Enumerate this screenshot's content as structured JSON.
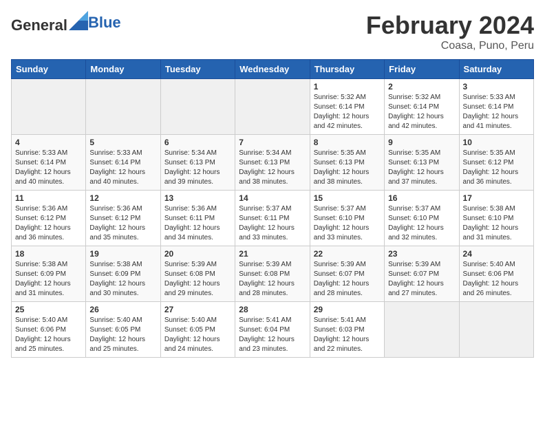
{
  "header": {
    "logo_general": "General",
    "logo_blue": "Blue",
    "month_year": "February 2024",
    "location": "Coasa, Puno, Peru"
  },
  "days_of_week": [
    "Sunday",
    "Monday",
    "Tuesday",
    "Wednesday",
    "Thursday",
    "Friday",
    "Saturday"
  ],
  "weeks": [
    [
      {
        "num": "",
        "info": ""
      },
      {
        "num": "",
        "info": ""
      },
      {
        "num": "",
        "info": ""
      },
      {
        "num": "",
        "info": ""
      },
      {
        "num": "1",
        "info": "Sunrise: 5:32 AM\nSunset: 6:14 PM\nDaylight: 12 hours\nand 42 minutes."
      },
      {
        "num": "2",
        "info": "Sunrise: 5:32 AM\nSunset: 6:14 PM\nDaylight: 12 hours\nand 42 minutes."
      },
      {
        "num": "3",
        "info": "Sunrise: 5:33 AM\nSunset: 6:14 PM\nDaylight: 12 hours\nand 41 minutes."
      }
    ],
    [
      {
        "num": "4",
        "info": "Sunrise: 5:33 AM\nSunset: 6:14 PM\nDaylight: 12 hours\nand 40 minutes."
      },
      {
        "num": "5",
        "info": "Sunrise: 5:33 AM\nSunset: 6:14 PM\nDaylight: 12 hours\nand 40 minutes."
      },
      {
        "num": "6",
        "info": "Sunrise: 5:34 AM\nSunset: 6:13 PM\nDaylight: 12 hours\nand 39 minutes."
      },
      {
        "num": "7",
        "info": "Sunrise: 5:34 AM\nSunset: 6:13 PM\nDaylight: 12 hours\nand 38 minutes."
      },
      {
        "num": "8",
        "info": "Sunrise: 5:35 AM\nSunset: 6:13 PM\nDaylight: 12 hours\nand 38 minutes."
      },
      {
        "num": "9",
        "info": "Sunrise: 5:35 AM\nSunset: 6:13 PM\nDaylight: 12 hours\nand 37 minutes."
      },
      {
        "num": "10",
        "info": "Sunrise: 5:35 AM\nSunset: 6:12 PM\nDaylight: 12 hours\nand 36 minutes."
      }
    ],
    [
      {
        "num": "11",
        "info": "Sunrise: 5:36 AM\nSunset: 6:12 PM\nDaylight: 12 hours\nand 36 minutes."
      },
      {
        "num": "12",
        "info": "Sunrise: 5:36 AM\nSunset: 6:12 PM\nDaylight: 12 hours\nand 35 minutes."
      },
      {
        "num": "13",
        "info": "Sunrise: 5:36 AM\nSunset: 6:11 PM\nDaylight: 12 hours\nand 34 minutes."
      },
      {
        "num": "14",
        "info": "Sunrise: 5:37 AM\nSunset: 6:11 PM\nDaylight: 12 hours\nand 33 minutes."
      },
      {
        "num": "15",
        "info": "Sunrise: 5:37 AM\nSunset: 6:10 PM\nDaylight: 12 hours\nand 33 minutes."
      },
      {
        "num": "16",
        "info": "Sunrise: 5:37 AM\nSunset: 6:10 PM\nDaylight: 12 hours\nand 32 minutes."
      },
      {
        "num": "17",
        "info": "Sunrise: 5:38 AM\nSunset: 6:10 PM\nDaylight: 12 hours\nand 31 minutes."
      }
    ],
    [
      {
        "num": "18",
        "info": "Sunrise: 5:38 AM\nSunset: 6:09 PM\nDaylight: 12 hours\nand 31 minutes."
      },
      {
        "num": "19",
        "info": "Sunrise: 5:38 AM\nSunset: 6:09 PM\nDaylight: 12 hours\nand 30 minutes."
      },
      {
        "num": "20",
        "info": "Sunrise: 5:39 AM\nSunset: 6:08 PM\nDaylight: 12 hours\nand 29 minutes."
      },
      {
        "num": "21",
        "info": "Sunrise: 5:39 AM\nSunset: 6:08 PM\nDaylight: 12 hours\nand 28 minutes."
      },
      {
        "num": "22",
        "info": "Sunrise: 5:39 AM\nSunset: 6:07 PM\nDaylight: 12 hours\nand 28 minutes."
      },
      {
        "num": "23",
        "info": "Sunrise: 5:39 AM\nSunset: 6:07 PM\nDaylight: 12 hours\nand 27 minutes."
      },
      {
        "num": "24",
        "info": "Sunrise: 5:40 AM\nSunset: 6:06 PM\nDaylight: 12 hours\nand 26 minutes."
      }
    ],
    [
      {
        "num": "25",
        "info": "Sunrise: 5:40 AM\nSunset: 6:06 PM\nDaylight: 12 hours\nand 25 minutes."
      },
      {
        "num": "26",
        "info": "Sunrise: 5:40 AM\nSunset: 6:05 PM\nDaylight: 12 hours\nand 25 minutes."
      },
      {
        "num": "27",
        "info": "Sunrise: 5:40 AM\nSunset: 6:05 PM\nDaylight: 12 hours\nand 24 minutes."
      },
      {
        "num": "28",
        "info": "Sunrise: 5:41 AM\nSunset: 6:04 PM\nDaylight: 12 hours\nand 23 minutes."
      },
      {
        "num": "29",
        "info": "Sunrise: 5:41 AM\nSunset: 6:03 PM\nDaylight: 12 hours\nand 22 minutes."
      },
      {
        "num": "",
        "info": ""
      },
      {
        "num": "",
        "info": ""
      }
    ]
  ]
}
